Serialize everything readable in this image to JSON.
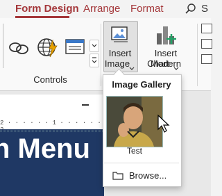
{
  "tabs": [
    {
      "label": "Form Design",
      "active": true
    },
    {
      "label": "Arrange",
      "active": false
    },
    {
      "label": "Format",
      "active": false
    }
  ],
  "ribbon": {
    "controls_group_label": "Controls",
    "insert_image_label_1": "Insert",
    "insert_image_label_2": "Image",
    "insert_modern_chart_label_1": "Insert Modern",
    "insert_modern_chart_label_2": "Chart"
  },
  "gallery": {
    "title": "Image Gallery",
    "items": [
      {
        "caption": "Test"
      }
    ],
    "browse_label": "Browse..."
  },
  "form": {
    "header_fragment": "n Menu",
    "ruler_text": "2 · · · · · · 1 · · · · · · 2"
  },
  "colors": {
    "accent": "#a4373a",
    "form_header_bg": "#1f3864"
  }
}
